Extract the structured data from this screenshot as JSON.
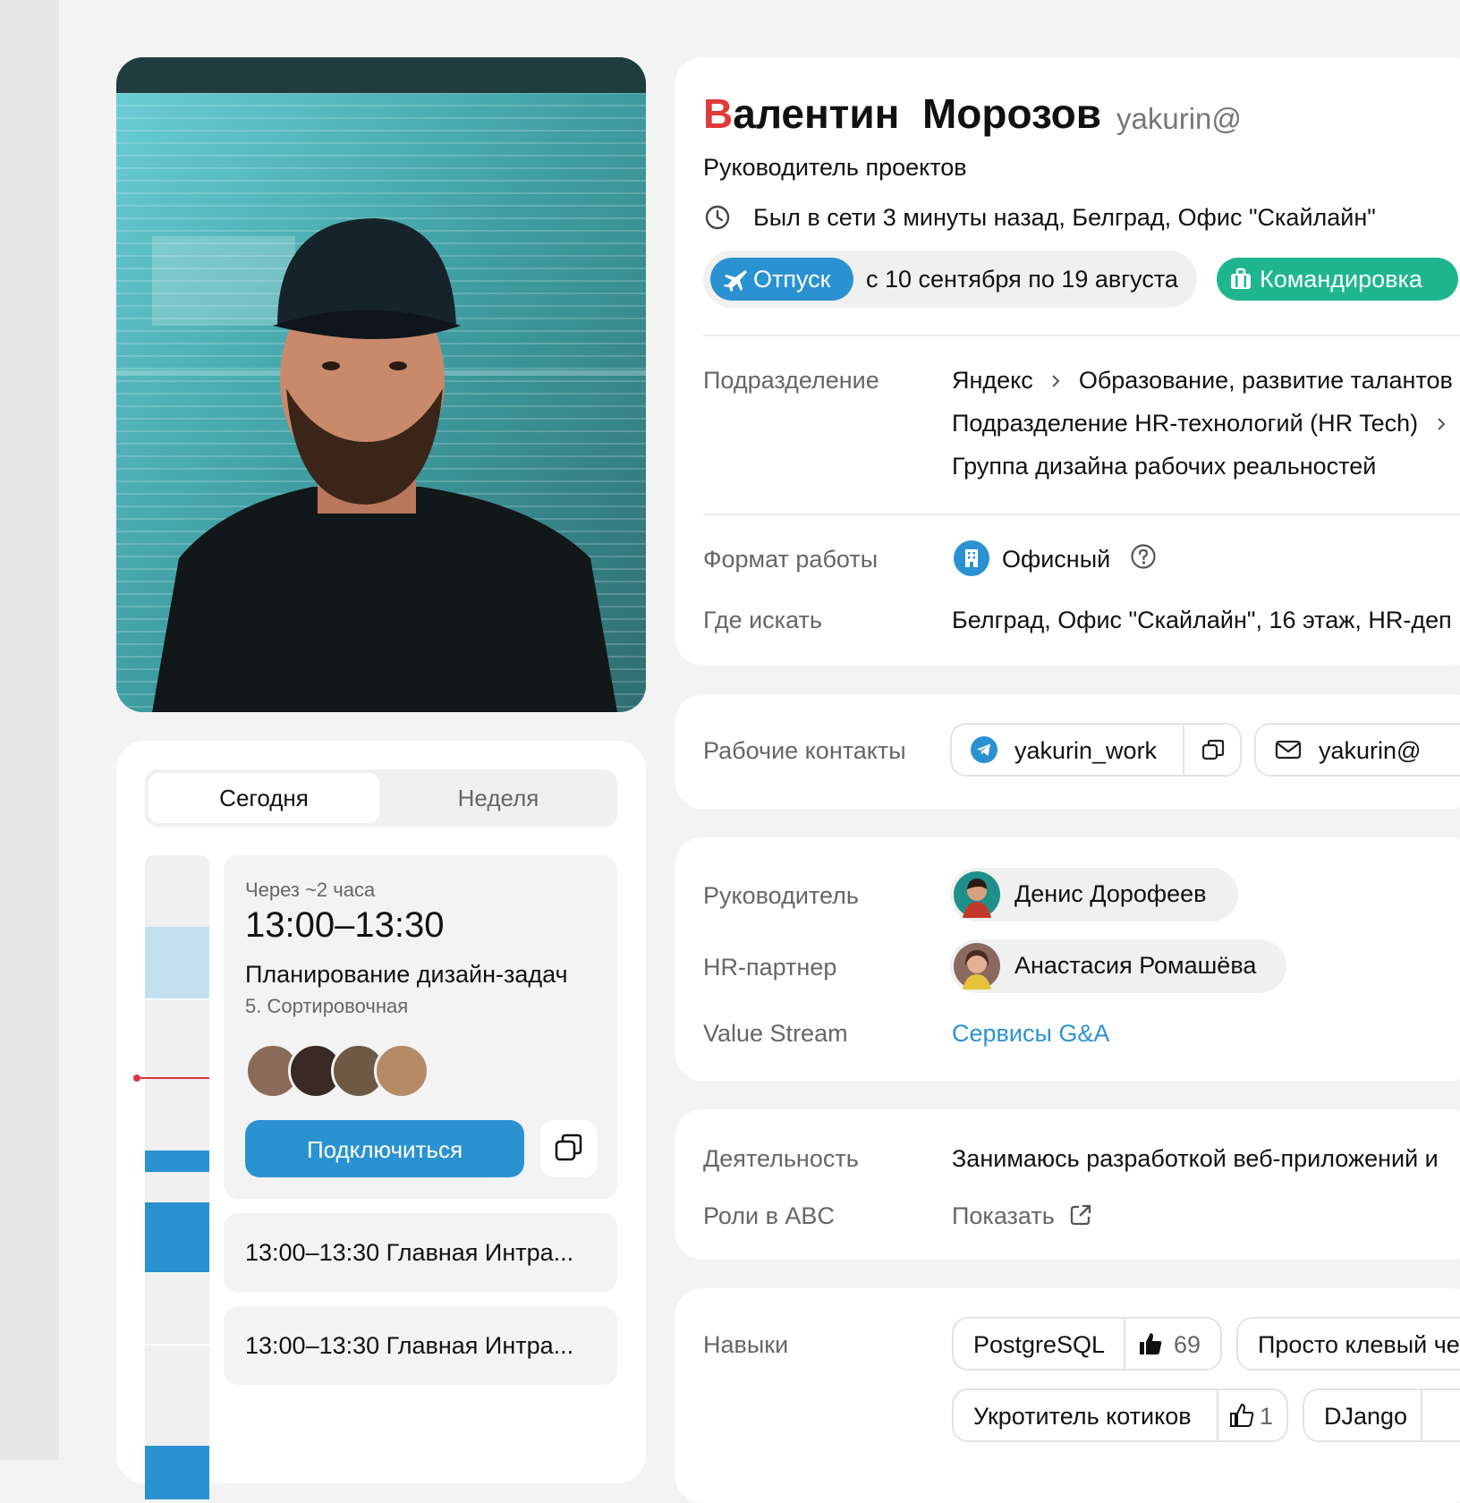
{
  "profile": {
    "first_name_initial": "В",
    "first_name_rest": "алентин",
    "last_name": "Морозов",
    "login": "yakurin@",
    "position": "Руководитель проектов",
    "online_status": "Был в сети 3 минуты назад, Белград, Офис \"Скайлайн\"",
    "vacation_label": "Отпуск",
    "vacation_dates": "с 10 сентября по 19 августа",
    "trip_label": "Командировка"
  },
  "department": {
    "label": "Подразделение",
    "path_1": "Яндекс",
    "path_2": "Образование, развитие талантов",
    "path_3": "Подразделение HR-технологий (HR Tech)",
    "path_4": "Группа дизайна рабочих реальностей"
  },
  "work_format": {
    "label": "Формат работы",
    "value": "Офисный",
    "location_label": "Где искать",
    "location_value": "Белград, Офис \"Скайлайн\", 16 этаж, HR-деп"
  },
  "contacts": {
    "label": "Рабочие контакты",
    "telegram": "yakurin_work",
    "email": "yakurin@"
  },
  "people": {
    "manager_label": "Руководитель",
    "manager_name": "Денис Дорофеев",
    "hr_label": "HR-партнер",
    "hr_name": "Анастасия Ромашёва",
    "stream_label": "Value Stream",
    "stream_value": "Сервисы G&A"
  },
  "activity": {
    "label": "Деятельность",
    "value": "Занимаюсь разработкой веб-приложений и",
    "abc_label": "Роли в ABC",
    "abc_value": "Показать"
  },
  "skills": {
    "label": "Навыки",
    "items": [
      {
        "name": "PostgreSQL",
        "likes": "69"
      },
      {
        "name": "Просто клевый че"
      },
      {
        "name": "Укротитель котиков",
        "likes": "1"
      },
      {
        "name": "DJango"
      }
    ]
  },
  "schedule": {
    "tab_today": "Сегодня",
    "tab_week": "Неделя",
    "next_in": "Через ~2 часа",
    "next_time": "13:00–13:30",
    "next_title": "Планирование дизайн-задач",
    "next_room": "5. Сортировочная",
    "join_label": "Подключиться",
    "events": [
      {
        "text": "13:00–13:30 Главная Интра..."
      },
      {
        "text": "13:00–13:30 Главная Интра..."
      }
    ]
  },
  "colors": {
    "accent_blue": "#2b92d1",
    "accent_green": "#1fb58f",
    "name_initial_red": "#e03a3a",
    "timeline_light": "#c3e0f1"
  }
}
